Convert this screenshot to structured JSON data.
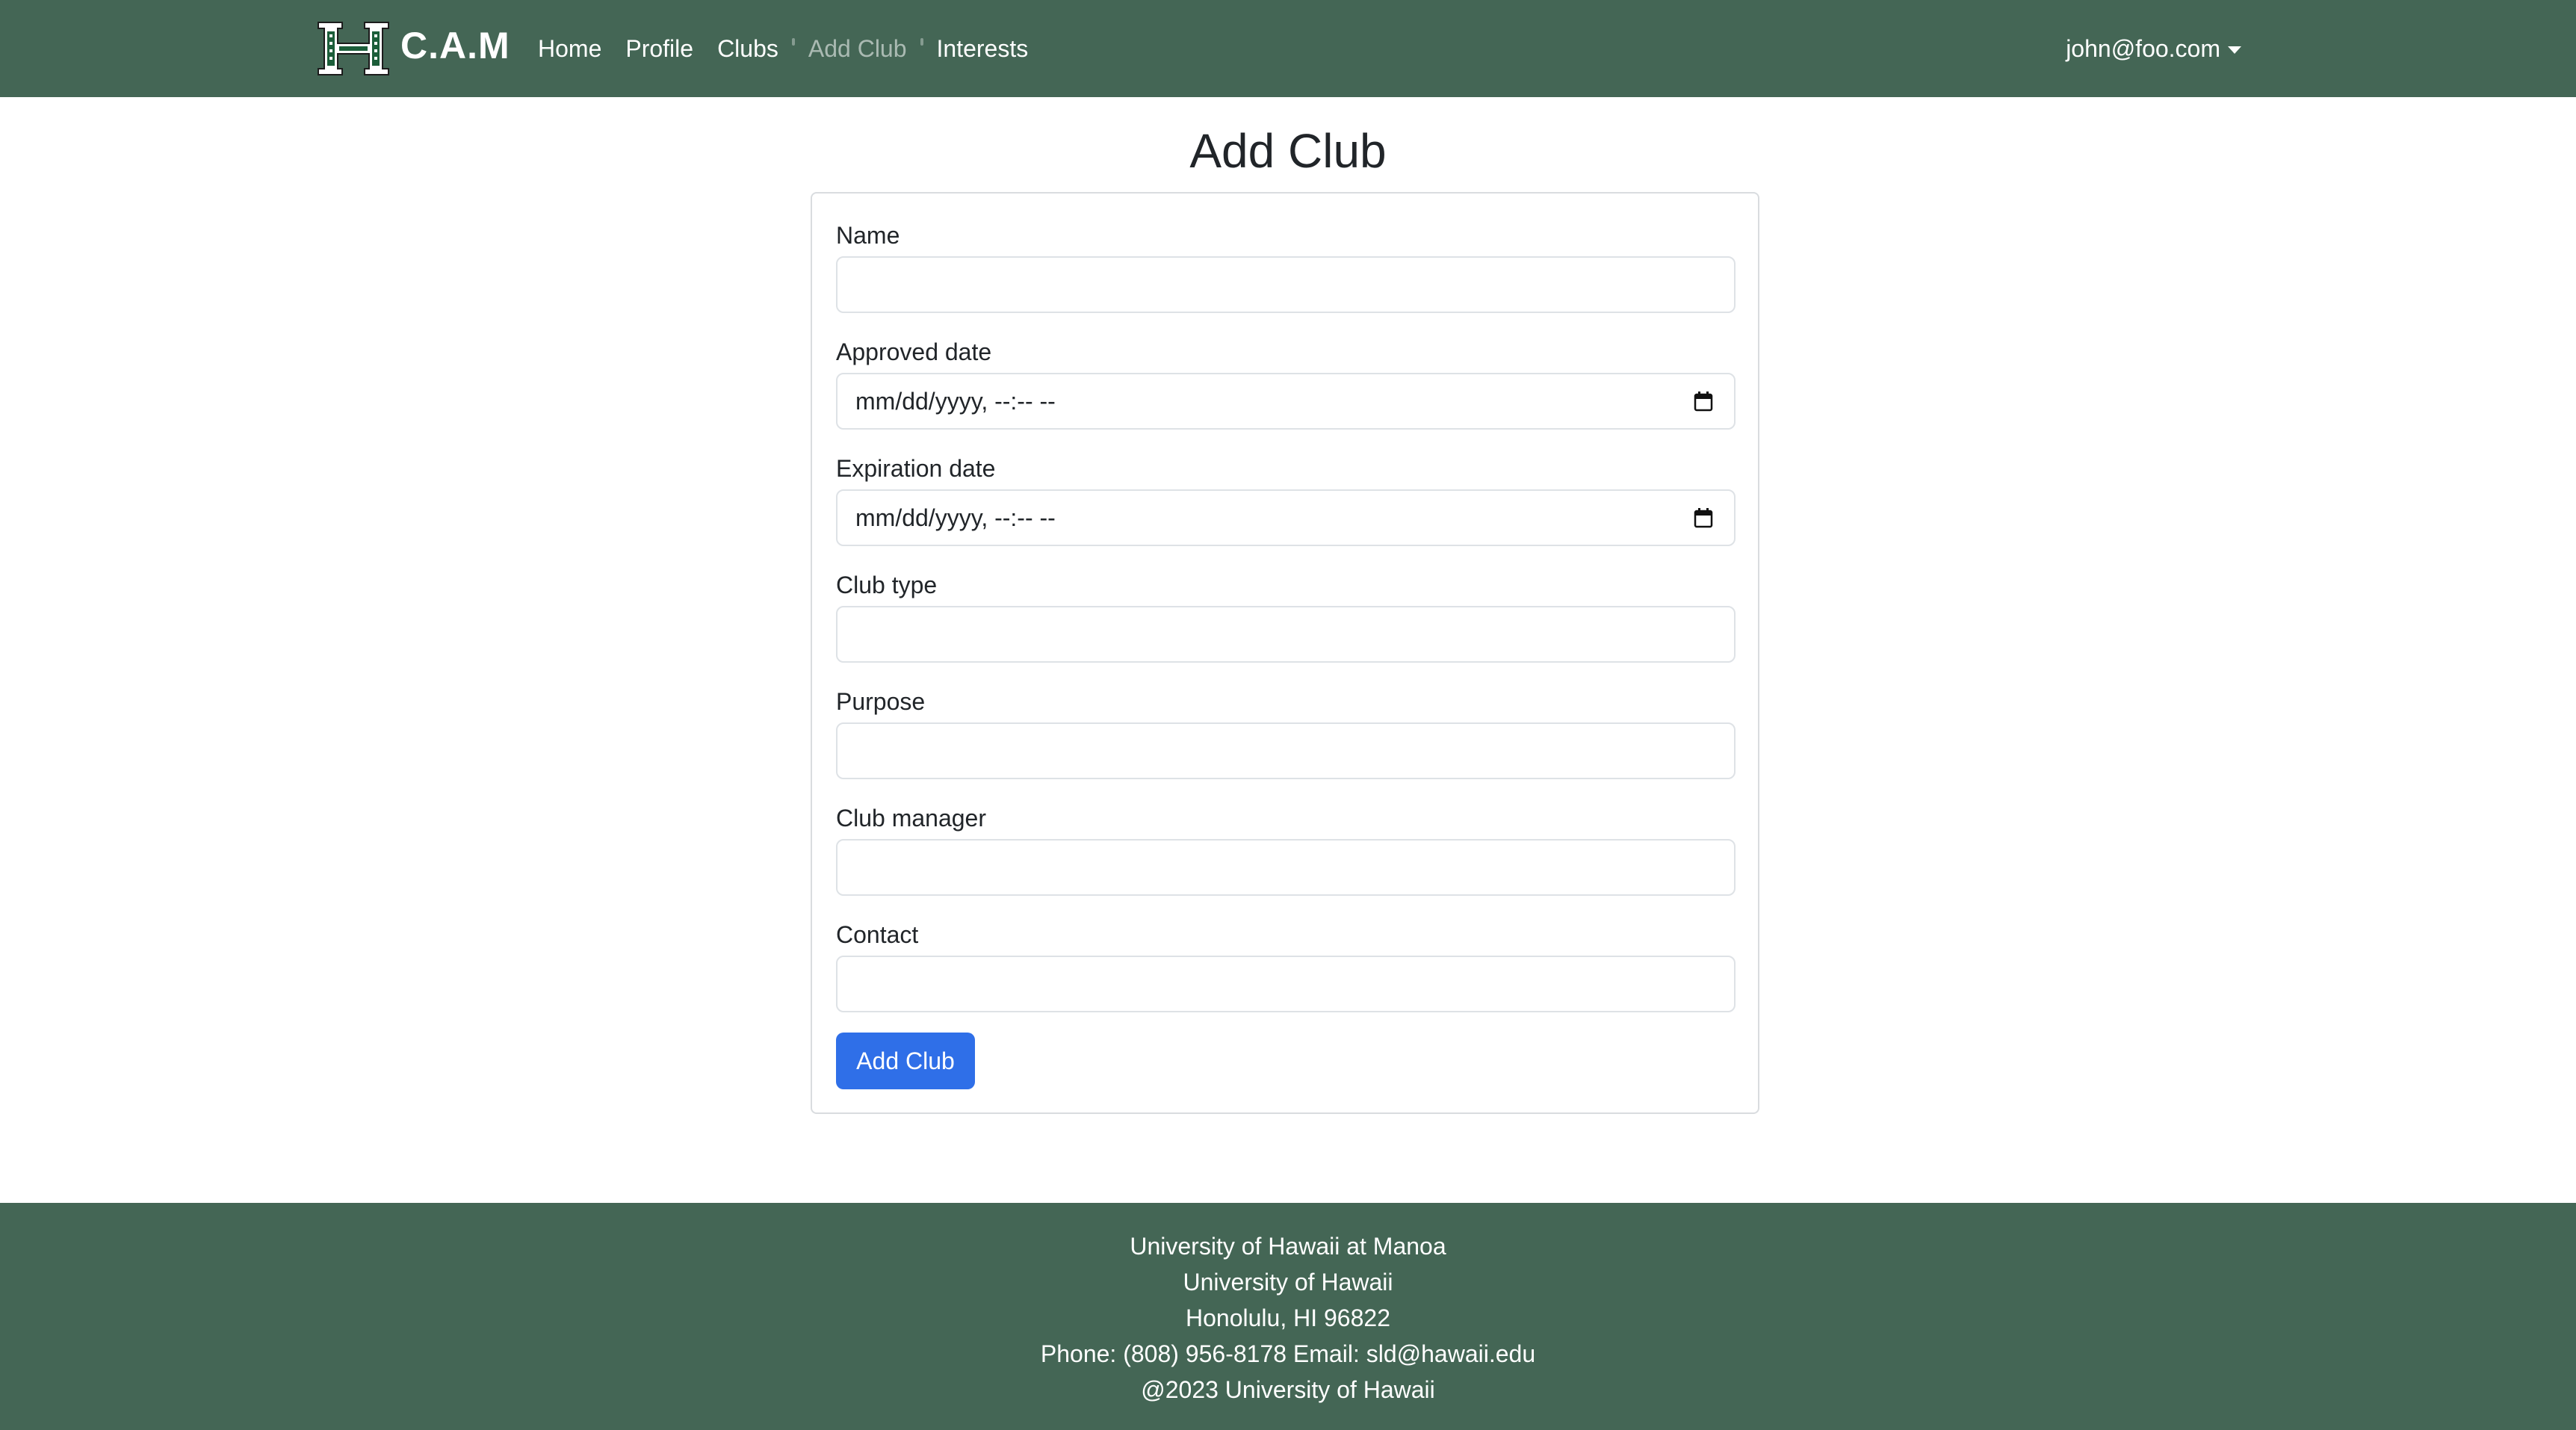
{
  "navbar": {
    "brand_text": "C.A.M",
    "logo_icon": "university-h-logo-icon",
    "links": [
      {
        "label": "Home",
        "active": false
      },
      {
        "label": "Profile",
        "active": false
      },
      {
        "label": "Clubs",
        "active": false
      },
      {
        "label": "Add Club",
        "active": true
      },
      {
        "label": "Interests",
        "active": false
      }
    ],
    "user_email": "john@foo.com",
    "user_menu_icon": "caret-down-icon"
  },
  "page": {
    "title": "Add Club"
  },
  "form": {
    "fields": {
      "name": {
        "label": "Name",
        "value": ""
      },
      "approved_date": {
        "label": "Approved date",
        "placeholder": "mm/dd/yyyy, --:-- --"
      },
      "expiration_date": {
        "label": "Expiration date",
        "placeholder": "mm/dd/yyyy, --:-- --"
      },
      "club_type": {
        "label": "Club type",
        "value": ""
      },
      "purpose": {
        "label": "Purpose",
        "value": ""
      },
      "club_manager": {
        "label": "Club manager",
        "value": ""
      },
      "contact": {
        "label": "Contact",
        "value": ""
      }
    },
    "submit_label": "Add Club",
    "calendar_icon": "calendar-icon"
  },
  "footer": {
    "line1": "University of Hawaii at Manoa",
    "line2": "University of Hawaii",
    "line3": "Honolulu, HI 96822",
    "line4": "Phone: (808) 956-8178 Email: sld@hawaii.edu",
    "line5": "@2023 University of Hawaii"
  },
  "colors": {
    "nav_bg": "#446655",
    "footer_bg": "#446655",
    "primary_button": "#2f6fe8",
    "active_link": "rgba(255,255,255,0.55)"
  }
}
